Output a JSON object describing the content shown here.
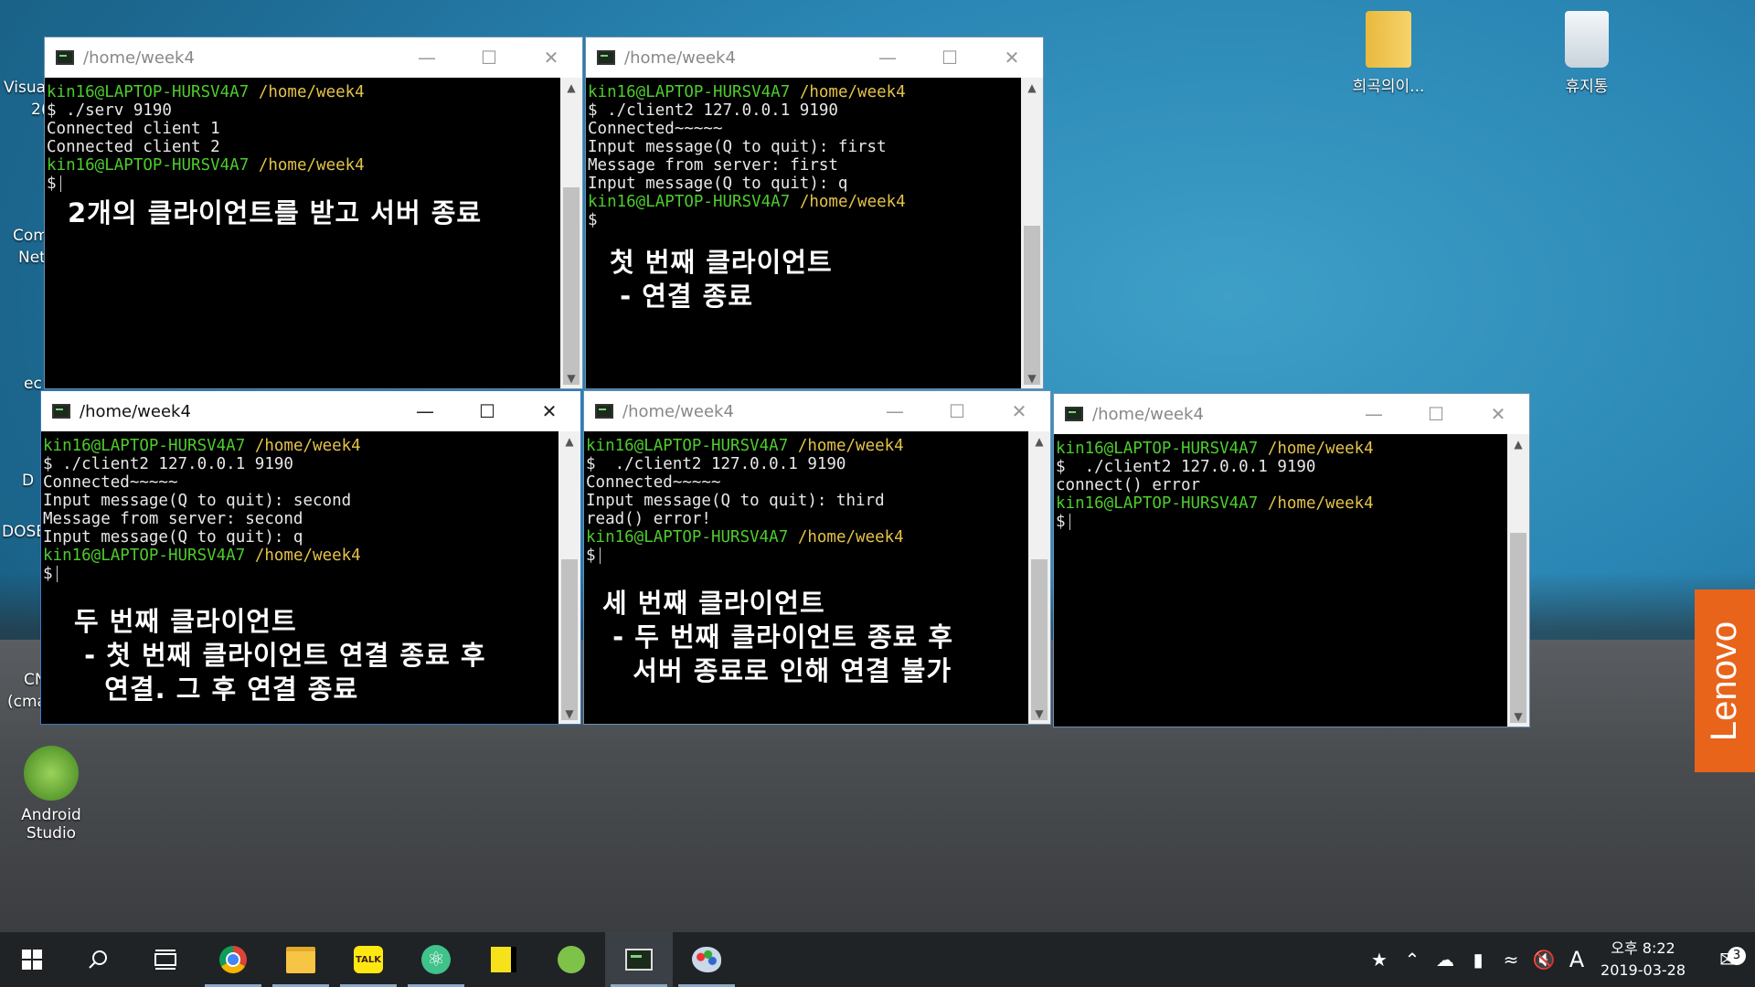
{
  "desktop": {
    "partial_labels": [
      "Visual",
      "2(",
      "Com",
      "Net",
      "ec",
      "D",
      "DOSE",
      "CN",
      "(cma"
    ],
    "icons": [
      {
        "label": "Android\nStudio",
        "icon": "android-studio-icon",
        "color": "#7fc24a"
      },
      {
        "label": "희곡의이...",
        "icon": "folder-zip-icon",
        "color": "#f0c94c"
      },
      {
        "label": "휴지통",
        "icon": "recycle-bin-icon",
        "color": "#dde6ee"
      }
    ]
  },
  "windows": [
    {
      "title": "/home/week4",
      "active": false,
      "lines": [
        {
          "user": "kin16@LAPTOP-HURSV4A7",
          "path": "/home/week4"
        },
        {
          "text": "$ ./serv 9190"
        },
        {
          "text": "Connected client 1"
        },
        {
          "text": "Connected client 2"
        },
        {
          "text": ""
        },
        {
          "user": "kin16@LAPTOP-HURSV4A7",
          "path": "/home/week4"
        },
        {
          "text": "$",
          "cursor": true
        }
      ],
      "note": "2개의 클라이언트를 받고 서버 종료"
    },
    {
      "title": "/home/week4",
      "active": false,
      "lines": [
        {
          "user": "kin16@LAPTOP-HURSV4A7",
          "path": "/home/week4"
        },
        {
          "text": "$ ./client2 127.0.0.1 9190"
        },
        {
          "text": "Connected~~~~~"
        },
        {
          "text": "Input message(Q to quit): first"
        },
        {
          "text": "Message from server: first"
        },
        {
          "text": "Input message(Q to quit): q"
        },
        {
          "text": ""
        },
        {
          "user": "kin16@LAPTOP-HURSV4A7",
          "path": "/home/week4"
        },
        {
          "text": "$"
        }
      ],
      "note": "첫 번째 클라이언트\n - 연결 종료"
    },
    {
      "title": "/home/week4",
      "active": true,
      "lines": [
        {
          "user": "kin16@LAPTOP-HURSV4A7",
          "path": "/home/week4"
        },
        {
          "text": "$ ./client2 127.0.0.1 9190"
        },
        {
          "text": "Connected~~~~~"
        },
        {
          "text": "Input message(Q to quit): second"
        },
        {
          "text": "Message from server: second"
        },
        {
          "text": "Input message(Q to quit): q"
        },
        {
          "text": ""
        },
        {
          "user": "kin16@LAPTOP-HURSV4A7",
          "path": "/home/week4"
        },
        {
          "text": "$",
          "cursor": true
        }
      ],
      "note": "두 번째 클라이언트\n - 첫 번째 클라이언트 연결 종료 후\n   연결. 그 후 연결 종료"
    },
    {
      "title": "/home/week4",
      "active": false,
      "lines": [
        {
          "user": "kin16@LAPTOP-HURSV4A7",
          "path": "/home/week4"
        },
        {
          "text": "$  ./client2 127.0.0.1 9190"
        },
        {
          "text": "Connected~~~~~"
        },
        {
          "text": "Input message(Q to quit): third"
        },
        {
          "text": "read() error!"
        },
        {
          "text": ""
        },
        {
          "user": "kin16@LAPTOP-HURSV4A7",
          "path": "/home/week4"
        },
        {
          "text": "$",
          "cursor": true
        }
      ],
      "note": "세 번째 클라이언트\n - 두 번째 클라이언트 종료 후\n   서버 종료로 인해 연결 불가"
    },
    {
      "title": "/home/week4",
      "active": false,
      "lines": [
        {
          "user": "kin16@LAPTOP-HURSV4A7",
          "path": "/home/week4"
        },
        {
          "text": "$  ./client2 127.0.0.1 9190"
        },
        {
          "text": "connect() error"
        },
        {
          "text": ""
        },
        {
          "user": "kin16@LAPTOP-HURSV4A7",
          "path": "/home/week4"
        },
        {
          "text": "$",
          "cursor": true
        }
      ],
      "note": ""
    }
  ],
  "taskbar": {
    "apps": [
      {
        "name": "start",
        "icon": "windows-start-icon",
        "color": "#ffffff",
        "running": false
      },
      {
        "name": "search",
        "icon": "search-icon",
        "color": "#ffffff",
        "running": false
      },
      {
        "name": "task-view",
        "icon": "task-view-icon",
        "color": "#ffffff",
        "running": false
      },
      {
        "name": "chrome",
        "icon": "chrome-icon",
        "color": "#db4437",
        "running": true
      },
      {
        "name": "file-explorer",
        "icon": "folder-icon",
        "color": "#f6c543",
        "running": true
      },
      {
        "name": "kakaotalk",
        "icon": "kakaotalk-icon",
        "color": "#ffe812",
        "running": true
      },
      {
        "name": "atom",
        "icon": "atom-icon",
        "color": "#40c28b",
        "running": true
      },
      {
        "name": "sticky-notes",
        "icon": "sticky-notes-icon",
        "color": "#f7e11b",
        "running": false
      },
      {
        "name": "android-studio",
        "icon": "android-studio-icon",
        "color": "#7fc24a",
        "running": false
      },
      {
        "name": "terminal",
        "icon": "terminal-icon",
        "color": "#9fc89f",
        "running": true,
        "active": true
      },
      {
        "name": "paint",
        "icon": "paint-icon",
        "color": "#8fb8e0",
        "running": true
      }
    ],
    "tray": {
      "ime": "A",
      "time": "오후 8:22",
      "date": "2019-03-28",
      "notifications": "3"
    }
  },
  "brand": {
    "lenovo": "Lenovo"
  }
}
